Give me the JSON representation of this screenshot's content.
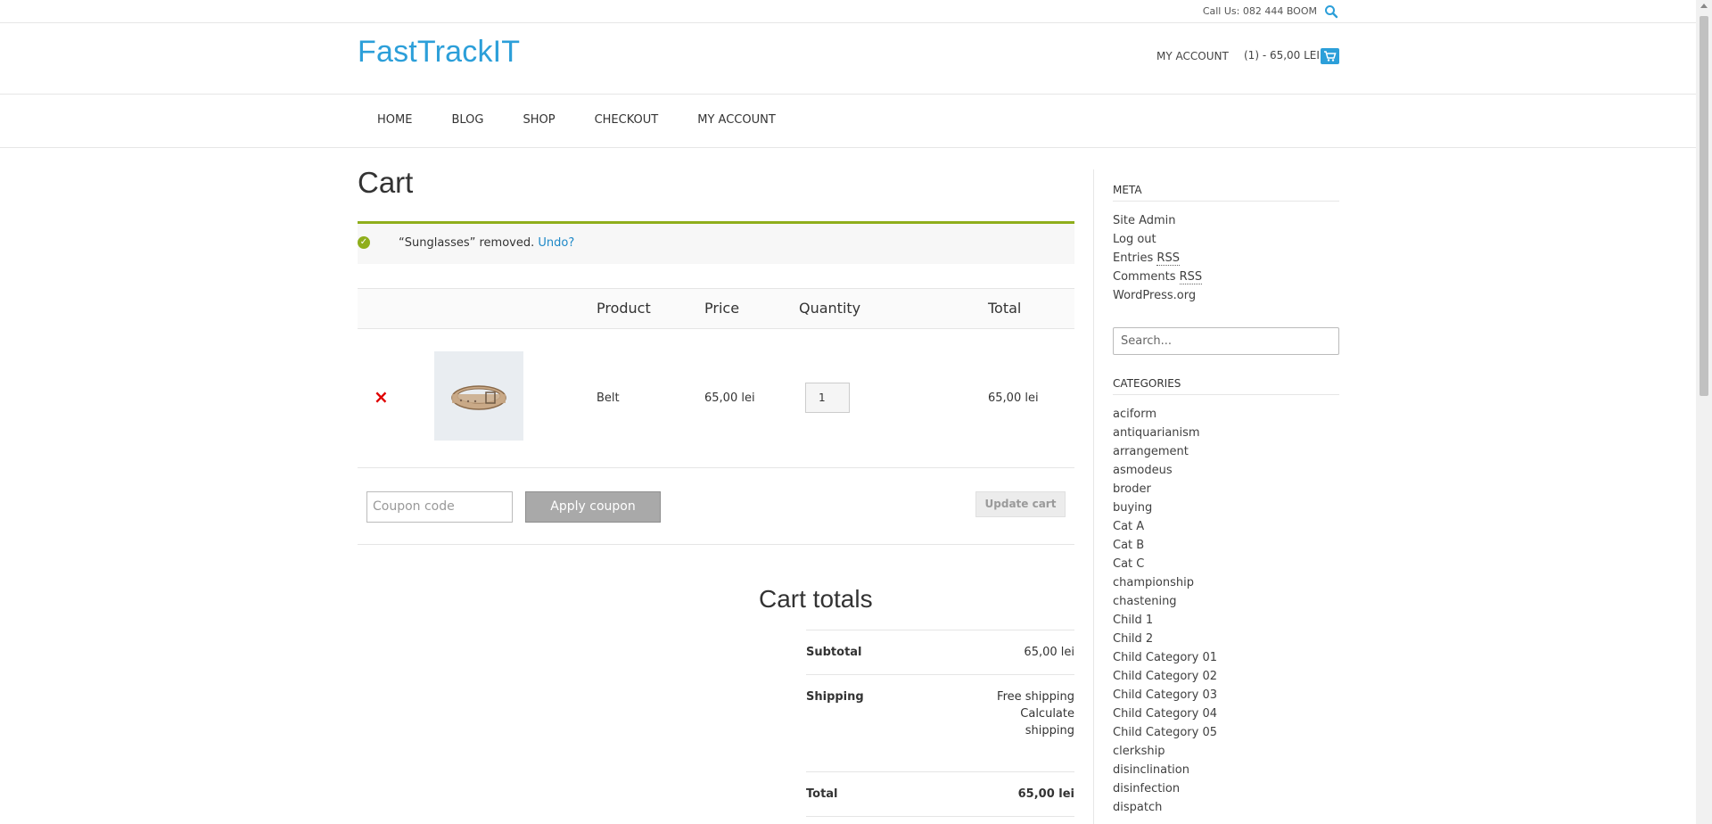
{
  "topbar": {
    "call": "Call Us: 082 444 BOOM"
  },
  "header": {
    "logo": "FastTrackIT",
    "account": "MY ACCOUNT",
    "cart_summary": "(1) - 65,00 LEI"
  },
  "nav": {
    "items": [
      "HOME",
      "BLOG",
      "SHOP",
      "CHECKOUT",
      "MY ACCOUNT"
    ]
  },
  "main": {
    "title": "Cart",
    "notice": {
      "message": "“Sunglasses” removed.",
      "undo": "Undo?"
    },
    "table": {
      "headers": {
        "product": "Product",
        "price": "Price",
        "quantity": "Quantity",
        "total": "Total"
      },
      "rows": [
        {
          "remove": "×",
          "product": "Belt",
          "price": "65,00 lei",
          "quantity": "1",
          "total": "65,00 lei"
        }
      ]
    },
    "coupon": {
      "placeholder": "Coupon code",
      "apply": "Apply coupon",
      "update": "Update cart"
    },
    "totals": {
      "title": "Cart totals",
      "subtotal_label": "Subtotal",
      "subtotal_value": "65,00 lei",
      "shipping_label": "Shipping",
      "shipping_value": "Free shipping",
      "calc_shipping_1": "Calculate",
      "calc_shipping_2": "shipping",
      "total_label": "Total",
      "total_value": "65,00 lei"
    }
  },
  "sidebar": {
    "meta_title": "META",
    "meta_items": {
      "site_admin": "Site Admin",
      "log_out": "Log out",
      "entries": "Entries",
      "comments": "Comments",
      "rss": "RSS",
      "wordpress": "WordPress.org"
    },
    "search_placeholder": "Search...",
    "categories_title": "CATEGORIES",
    "categories": [
      "aciform",
      "antiquarianism",
      "arrangement",
      "asmodeus",
      "broder",
      "buying",
      "Cat A",
      "Cat B",
      "Cat C",
      "championship",
      "chastening",
      "Child 1",
      "Child 2",
      "Child Category 01",
      "Child Category 02",
      "Child Category 03",
      "Child Category 04",
      "Child Category 05",
      "clerkship",
      "disinclination",
      "disinfection",
      "dispatch"
    ]
  },
  "colors": {
    "accent": "#2c9fd9",
    "notice": "#8fae1b",
    "remove": "#e00000"
  }
}
